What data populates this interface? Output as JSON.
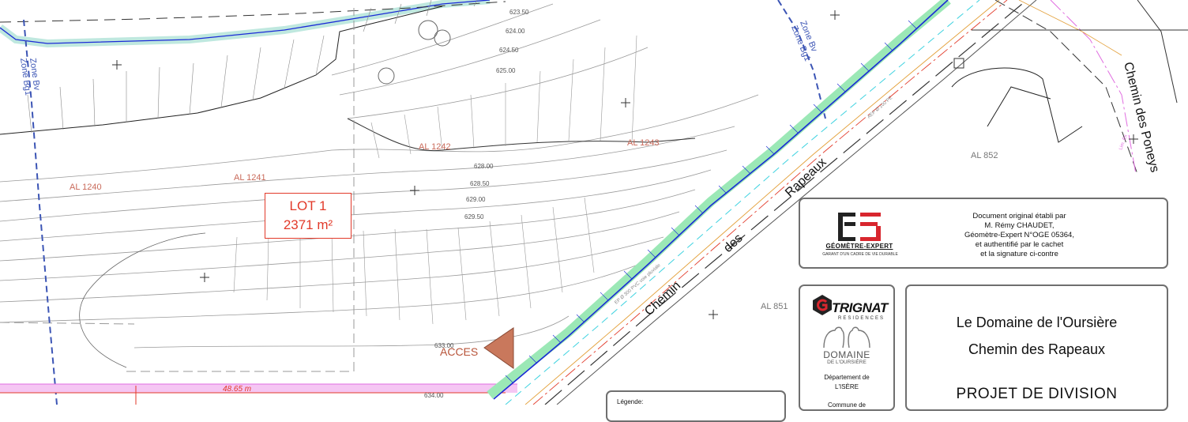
{
  "plan": {
    "contour_labels": [
      "623.50",
      "624.00",
      "624.50",
      "625.00",
      "628.00",
      "628.50",
      "629.00",
      "629.50",
      "633.00",
      "634.00"
    ],
    "parcels": [
      "AL 1240",
      "AL 1241",
      "AL 1242",
      "AL 1243",
      "AL 852",
      "AL 851"
    ],
    "zone_labels": [
      "Zone Bv",
      "Zone Bg1",
      "Zone Bv",
      "Zone Bg1"
    ],
    "road_names": [
      "Chemin",
      "des",
      "Rapeaux",
      "Chemin des Poneys"
    ],
    "dimension": "48.65 m",
    "small_annotations": [
      "EP Ø 300 PVC voie pluviale",
      "AEP Ø 100 PE",
      "Lim. Ex"
    ]
  },
  "lot": {
    "name": "LOT 1",
    "area": "2371 m²"
  },
  "acces_label": "ACCES",
  "certification": {
    "logo_name": "GÉOMÈTRE-EXPERT",
    "logo_tagline": "GARANT D'UN CADRE DE VIE DURABLE",
    "lines": [
      "Document original établi par",
      "M. Rémy CHAUDET,",
      "Géomètre-Expert N°OGE 05364,",
      "et authentifié par le cachet",
      "et la signature ci-contre"
    ]
  },
  "developer": {
    "brand": "TRIGNAT",
    "brand_sub": "RESIDENCES",
    "domain_name": "DOMAINE",
    "domain_sub": "DE L'OURSIÈRE",
    "dept_lines": [
      "Département de",
      "L'ISÈRE"
    ],
    "commune": "Commune de"
  },
  "titleblock": {
    "line1": "Le Domaine de l'Oursière",
    "line2": "Chemin des Rapeaux",
    "project": "PROJET DE DIVISION"
  },
  "legend": {
    "label": "Légende:"
  },
  "colors": {
    "lot_red": "#e23a2a",
    "road_blue": "#1b2bd6",
    "slope_green": "#5fd68a",
    "zone_blue": "#3c55b5",
    "pink_band": "#f0b3ef",
    "acces_brown": "#c9785c"
  }
}
